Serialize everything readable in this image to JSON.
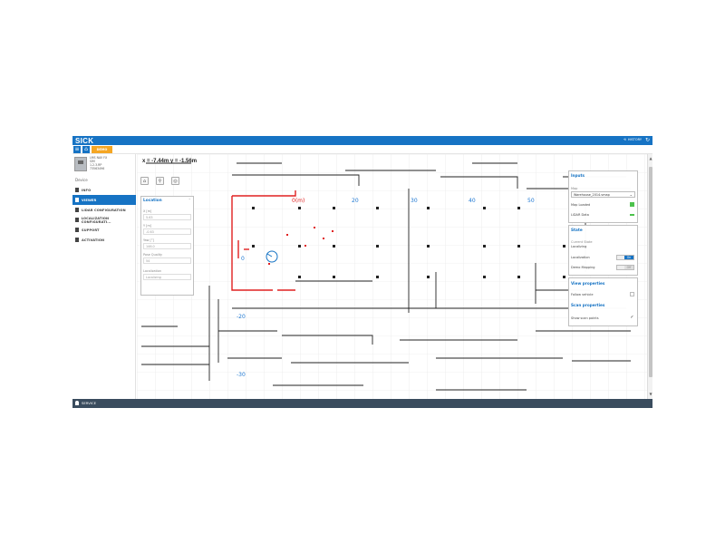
{
  "header": {
    "logo": "SICK",
    "history_label": "HISTORY",
    "mode_badge": "DEMO MODE"
  },
  "device": {
    "lines": [
      "LMS NAV FX",
      "SIM",
      "1.2.3.RP",
      "73563496"
    ]
  },
  "sidebar": {
    "section_label": "Device",
    "items": [
      {
        "label": "INFO",
        "active": false
      },
      {
        "label": "VIEWER",
        "active": true
      },
      {
        "label": "LIDAR CONFIGURATION",
        "active": false
      },
      {
        "label": "LOCALIZATION CONFIGURATI...",
        "active": false
      },
      {
        "label": "SUPPORT",
        "active": false
      },
      {
        "label": "ACTIVATION",
        "active": false
      }
    ]
  },
  "map": {
    "cursor_coords": "x = -7.44m y = -1.56m",
    "axis_labels": {
      "x": [
        "0(m)",
        "20",
        "30",
        "40",
        "50"
      ],
      "y": [
        "0",
        "-20",
        "-30"
      ]
    }
  },
  "location_panel": {
    "title": "Location",
    "fields": [
      {
        "label": "X [m]",
        "value": "5.63"
      },
      {
        "label": "Y [m]",
        "value": "-0.63"
      },
      {
        "label": "Yaw [°]",
        "value": "146.0"
      },
      {
        "label": "Pose Quality",
        "value": "54"
      },
      {
        "label": "Localization",
        "value": "Localizing"
      }
    ]
  },
  "inputs_panel": {
    "title": "Inputs",
    "map_label": "Map",
    "map_value": "Warehouse_2014.vmap",
    "map_loaded_label": "Map Loaded",
    "lidar_data_label": "LiDAR Data"
  },
  "state_panel": {
    "title": "State",
    "current_state_label": "Current State",
    "current_state_value": "Localizing",
    "localization_label": "Localization",
    "localization_toggle": "On",
    "demo_mapping_label": "Demo Mapping",
    "demo_mapping_toggle": "Off"
  },
  "view_panel": {
    "title": "View properties",
    "follow_vehicle_label": "Follow vehicle",
    "scan_title": "Scan properties",
    "show_scan_points_label": "Show scan points"
  },
  "footer": {
    "service_label": "SERVICE"
  },
  "colors": {
    "brand_blue": "#1673c4",
    "demo_orange": "#f5a623",
    "footer_dark": "#3a4c5e",
    "scan_red": "#e02020",
    "status_green": "#4cc24c"
  }
}
